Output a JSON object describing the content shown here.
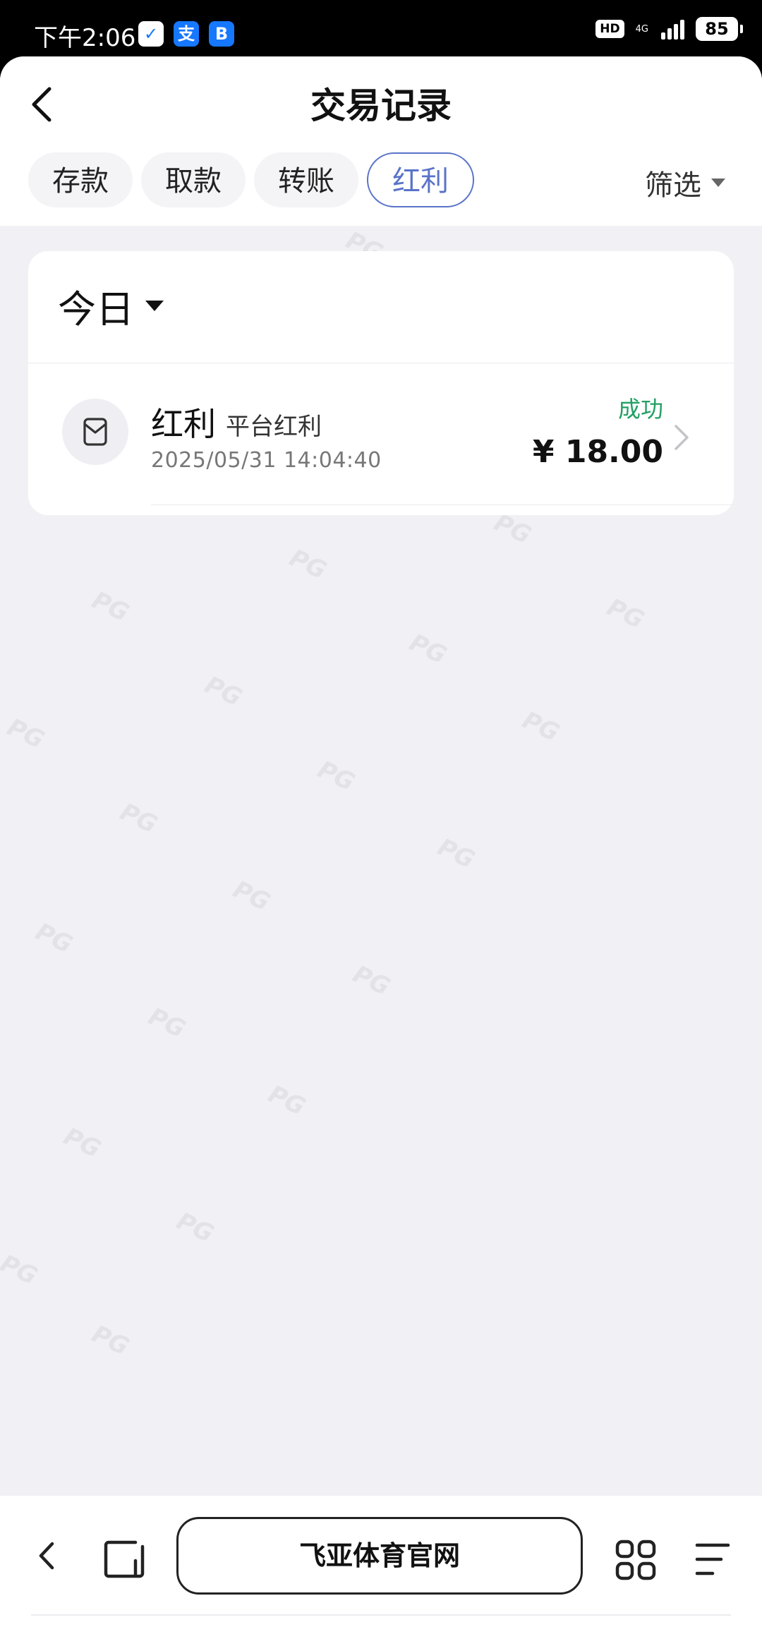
{
  "status_bar": {
    "time": "下午2:06",
    "apps": [
      {
        "name": "wechat-pay-icon",
        "glyph": "✓"
      },
      {
        "name": "alipay-icon",
        "glyph": "支"
      },
      {
        "name": "bilibili-icon",
        "glyph": "B"
      }
    ],
    "hd": "HD",
    "network": "4G",
    "battery": "85"
  },
  "header": {
    "title": "交易记录",
    "tabs": [
      {
        "label": "存款",
        "active": false
      },
      {
        "label": "取款",
        "active": false
      },
      {
        "label": "转账",
        "active": false
      },
      {
        "label": "红利",
        "active": true
      }
    ],
    "filter_label": "筛选"
  },
  "records": {
    "period": "今日",
    "items": [
      {
        "type": "红利",
        "subtype": "平台红利",
        "datetime": "2025/05/31 14:04:40",
        "status": "成功",
        "amount": "¥ 18.00"
      }
    ]
  },
  "browser": {
    "site_name": "飞亚体育官网"
  },
  "colors": {
    "accent": "#5a73c9",
    "success": "#23a063",
    "background": "#f1f1f5"
  }
}
